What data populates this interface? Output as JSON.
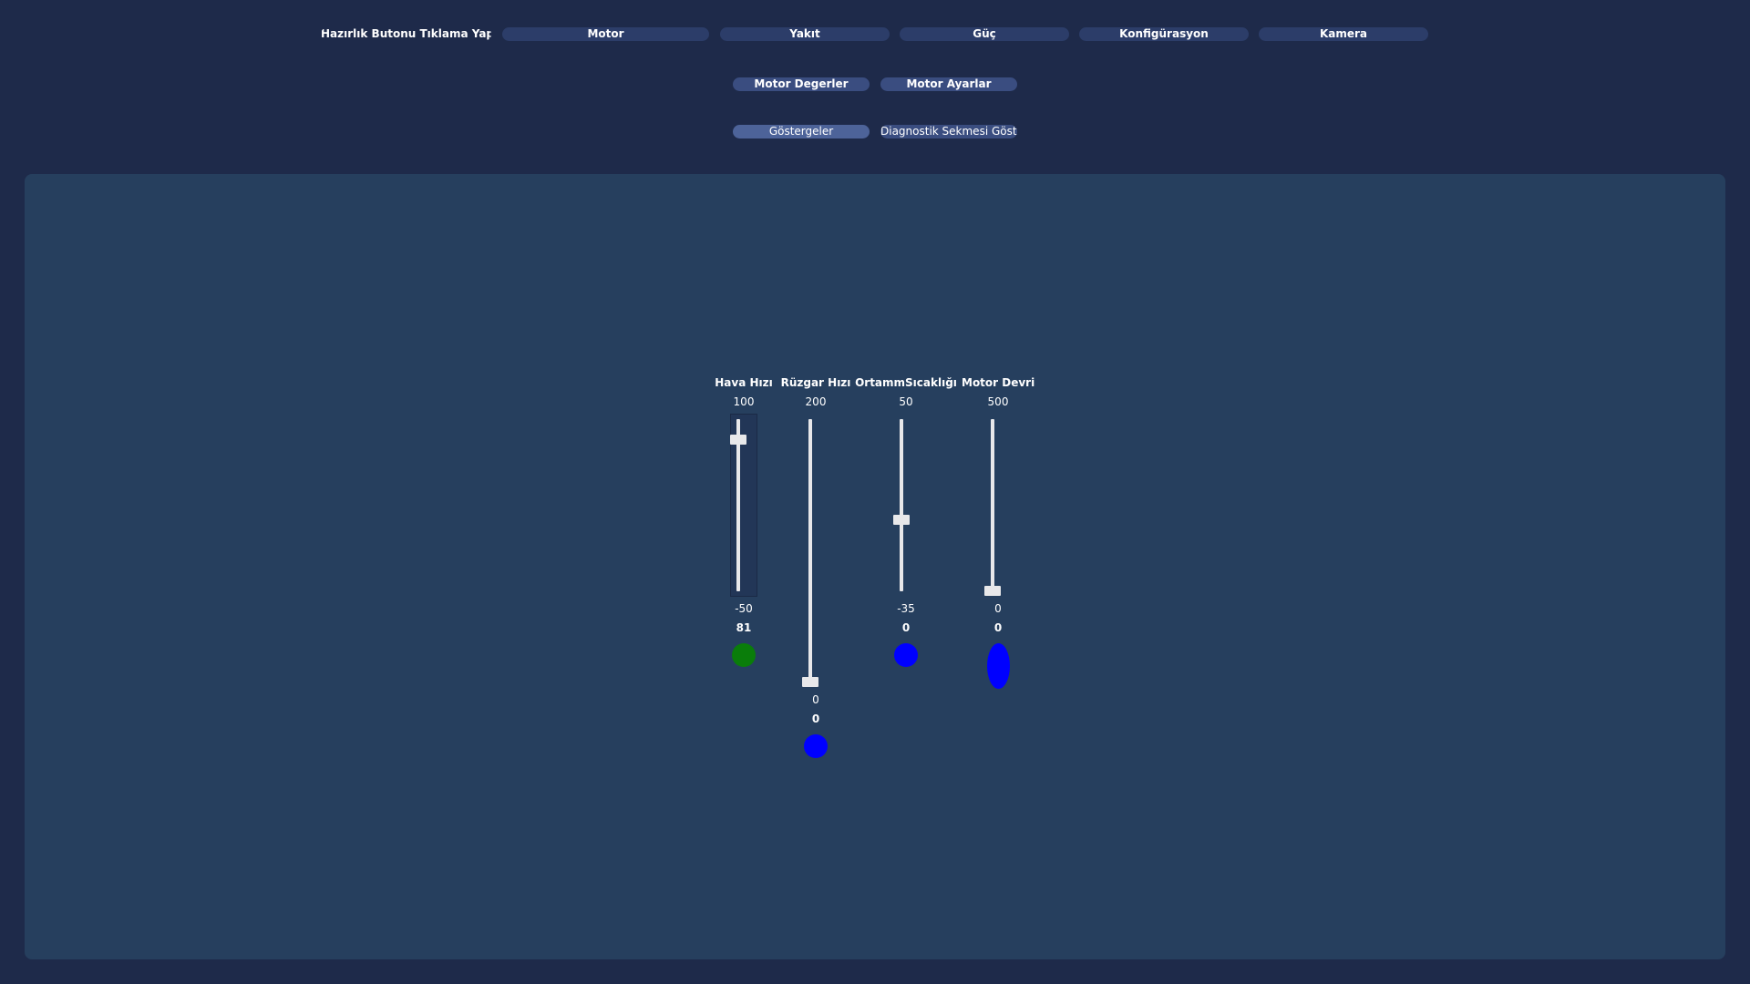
{
  "top_nav": {
    "items": [
      {
        "label": "Hazırlık Butonu Tıklama Yapınız"
      },
      {
        "label": "Motor"
      },
      {
        "label": "Yakıt"
      },
      {
        "label": "Güç"
      },
      {
        "label": "Konfigürasyon"
      },
      {
        "label": "Kamera"
      }
    ]
  },
  "sub_nav": {
    "motor_degerler": "Motor Degerler",
    "motor_ayarlar": "Motor Ayarlar"
  },
  "view_nav": {
    "gostergeler": "Göstergeler",
    "diagnostik": "Diagnostik Sekmesi Gösterin"
  },
  "sliders": [
    {
      "title": "Hava Hızı",
      "max": "100",
      "min": "-50",
      "value": "81",
      "level": 0.87,
      "indicator_color": "#0a7d0a"
    },
    {
      "title": "Rüzgar Hızı",
      "max": "200",
      "min": "0",
      "value": "0",
      "level": 0.0,
      "indicator_color": "#0000ff"
    },
    {
      "title": "OrtammSıcaklığı",
      "max": "50",
      "min": "-35",
      "value": "0",
      "level": 0.41,
      "indicator_color": "#0000ff"
    },
    {
      "title": "Motor Devri",
      "max": "500",
      "min": "0",
      "value": "0",
      "level": 0.0,
      "indicator_color": "#0000ff"
    }
  ],
  "colors": {
    "background": "#1e2a4a",
    "panel": "#263f5e",
    "button": "#2c3d69",
    "button_active": "#4d6399",
    "track": "#e8e8ea"
  }
}
